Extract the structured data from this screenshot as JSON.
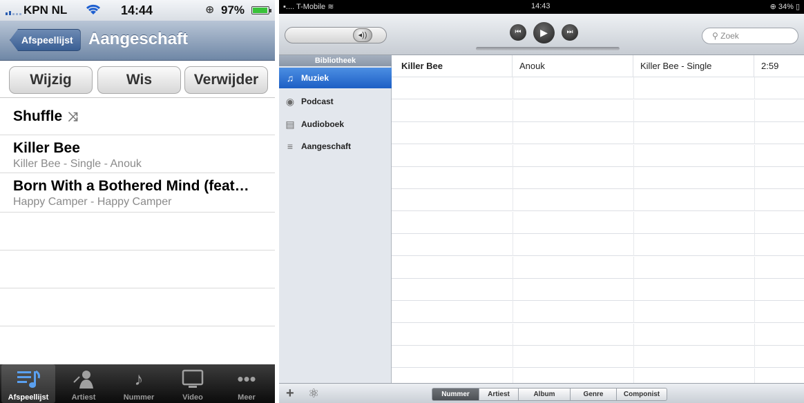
{
  "iphone": {
    "status": {
      "carrier": "KPN NL",
      "time": "14:44",
      "battery": "97%"
    },
    "nav": {
      "back_label": "Afspeellijst",
      "title": "Aangeschaft"
    },
    "buttons": {
      "edit": "Wijzig",
      "clear": "Wis",
      "delete": "Verwijder"
    },
    "shuffle_label": "Shuffle",
    "songs": [
      {
        "title": "Killer Bee",
        "subtitle": "Killer Bee - Single - Anouk"
      },
      {
        "title": "Born With a Bothered Mind (feat…",
        "subtitle": "Happy Camper - Happy Camper"
      }
    ],
    "tabs": [
      {
        "label": "Afspeellijst",
        "icon": "playlist-icon"
      },
      {
        "label": "Artiest",
        "icon": "artist-icon"
      },
      {
        "label": "Nummer",
        "icon": "music-note-icon"
      },
      {
        "label": "Video",
        "icon": "video-icon"
      },
      {
        "label": "Meer",
        "icon": "more-icon"
      }
    ],
    "colors": {
      "nav_bar": "#6f87a6",
      "active_tab_icon": "#5aa0f0"
    }
  },
  "ipad": {
    "status": {
      "carrier": "T-Mobile",
      "time": "14:43",
      "battery": "34%"
    },
    "search_placeholder": "Zoek",
    "sidebar": {
      "header": "Bibliotheek",
      "items": [
        {
          "label": "Muziek",
          "icon": "music-note-icon"
        },
        {
          "label": "Podcast",
          "icon": "podcast-icon"
        },
        {
          "label": "Audioboek",
          "icon": "audiobook-icon"
        },
        {
          "label": "Aangeschaft",
          "icon": "playlist-icon"
        }
      ]
    },
    "tracks": [
      {
        "name": "Killer Bee",
        "artist": "Anouk",
        "album": "Killer Bee - Single",
        "time": "2:59"
      }
    ],
    "sort_tabs": [
      "Nummer",
      "Artiest",
      "Album",
      "Genre",
      "Componist"
    ],
    "colors": {
      "sidebar_selected": "#1d5fc4"
    }
  }
}
